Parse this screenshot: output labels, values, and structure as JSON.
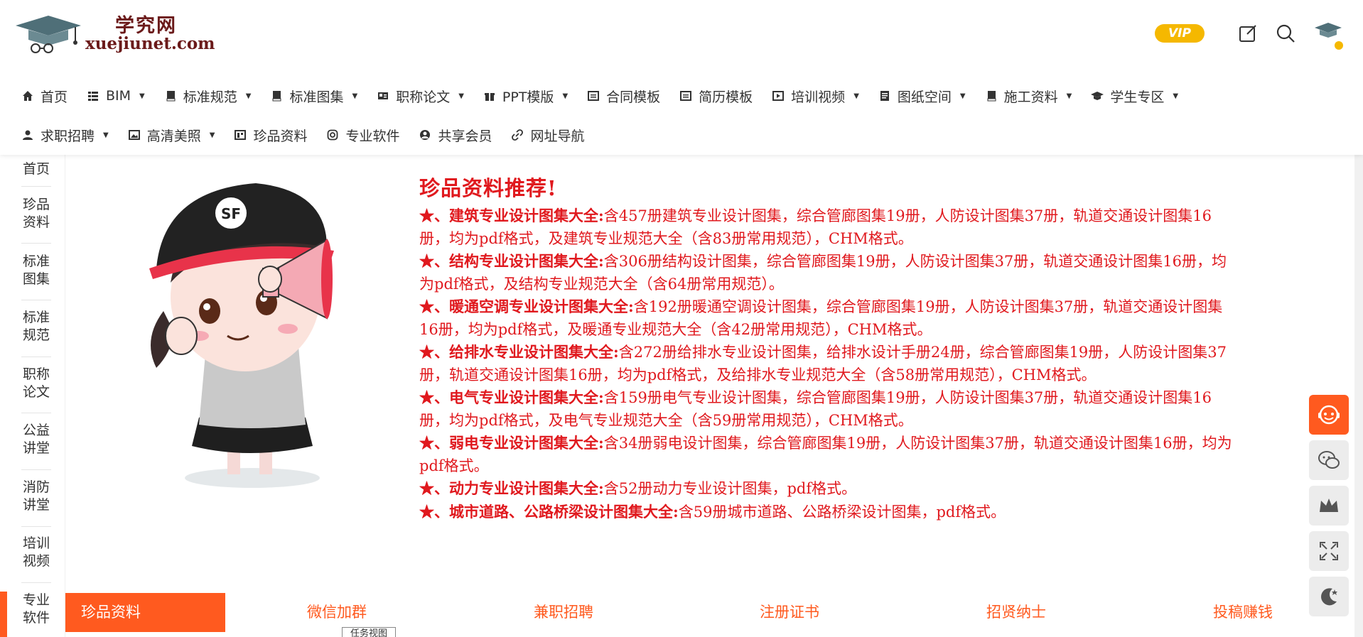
{
  "brand": {
    "title": "学究网",
    "url": "xuejiunet.com"
  },
  "header_right": {
    "vip_label": "VIP",
    "icons": [
      "edit-icon",
      "search-icon",
      "avatar"
    ],
    "avatar_caption": "学究网"
  },
  "nav": {
    "row1": [
      {
        "label": "首页",
        "icon": "home-icon",
        "dropdown": false
      },
      {
        "label": "BIM",
        "icon": "grid-icon",
        "dropdown": true
      },
      {
        "label": "标准规范",
        "icon": "book-icon",
        "dropdown": true
      },
      {
        "label": "标准图集",
        "icon": "book-icon",
        "dropdown": true
      },
      {
        "label": "职称论文",
        "icon": "id-card-icon",
        "dropdown": true
      },
      {
        "label": "PPT模版",
        "icon": "gift-icon",
        "dropdown": true
      },
      {
        "label": "合同模板",
        "icon": "list-icon",
        "dropdown": false
      },
      {
        "label": "简历模板",
        "icon": "list-icon",
        "dropdown": false
      },
      {
        "label": "培训视频",
        "icon": "video-icon",
        "dropdown": true
      },
      {
        "label": "图纸空间",
        "icon": "doc-icon",
        "dropdown": true
      },
      {
        "label": "施工资料",
        "icon": "book-icon",
        "dropdown": true
      },
      {
        "label": "学生专区",
        "icon": "graduation-cap-icon",
        "dropdown": true
      }
    ],
    "row2": [
      {
        "label": "求职招聘",
        "icon": "user-icon",
        "dropdown": true
      },
      {
        "label": "高清美照",
        "icon": "image-icon",
        "dropdown": true
      },
      {
        "label": "珍品资料",
        "icon": "folder-icon",
        "dropdown": false
      },
      {
        "label": "专业软件",
        "icon": "instagram-icon",
        "dropdown": false
      },
      {
        "label": "共享会员",
        "icon": "share-icon",
        "dropdown": false
      },
      {
        "label": "网址导航",
        "icon": "link-icon",
        "dropdown": false
      }
    ]
  },
  "leftnav": {
    "items": [
      {
        "label": "首页"
      },
      {
        "label": "珍品资料"
      },
      {
        "label": "标准图集"
      },
      {
        "label": "标准规范"
      },
      {
        "label": "职称论文"
      },
      {
        "label": "公益讲堂"
      },
      {
        "label": "消防讲堂"
      },
      {
        "label": "培训视频"
      },
      {
        "label": "专业软件"
      }
    ]
  },
  "banner": {
    "title": "珍品资料推荐!",
    "items": [
      {
        "key": "★、建筑专业设计图集大全:",
        "text": "含457册建筑专业设计图集，综合管廊图集19册，人防设计图集37册，轨道交通设计图集16册，均为pdf格式，及建筑专业规范大全（含83册常用规范），CHM格式。"
      },
      {
        "key": "★、结构专业设计图集大全:",
        "text": "含306册结构设计图集，综合管廊图集19册，人防设计图集37册，轨道交通设计图集16册，均为pdf格式，及结构专业规范大全（含64册常用规范）。"
      },
      {
        "key": "★、暖通空调专业设计图集大全:",
        "text": "含192册暖通空调设计图集，综合管廊图集19册，人防设计图集37册，轨道交通设计图集16册，均为pdf格式，及暖通专业规范大全（含42册常用规范），CHM格式。"
      },
      {
        "key": "★、给排水专业设计图集大全:",
        "text": "含272册给排水专业设计图集，给排水设计手册24册，综合管廊图集19册，人防设计图集37册，轨道交通设计图集16册，均为pdf格式，及给排水专业规范大全（含58册常用规范），CHM格式。"
      },
      {
        "key": "★、电气专业设计图集大全:",
        "text": "含159册电气专业设计图集，综合管廊图集19册，人防设计图集37册，轨道交通设计图集16册，均为pdf格式，及电气专业规范大全（含59册常用规范），CHM格式。"
      },
      {
        "key": "★、弱电专业设计图集大全:",
        "text": "含34册弱电设计图集，综合管廊图集19册，人防设计图集37册，轨道交通设计图集16册，均为pdf格式。"
      },
      {
        "key": "★、动力专业设计图集大全:",
        "text": "含52册动力专业设计图集，pdf格式。"
      },
      {
        "key": "★、城市道路、公路桥梁设计图集大全:",
        "text": "含59册城市道路、公路桥梁设计图集，pdf格式。"
      }
    ]
  },
  "bottombar": {
    "active": "珍品资料",
    "links": [
      "微信加群",
      "兼职招聘",
      "注册证书",
      "招贤纳士",
      "投稿赚钱"
    ],
    "tooltip": "任务视图"
  },
  "floatbar": [
    "customer-service-icon",
    "wechat-icon",
    "crown-icon",
    "fullscreen-icon",
    "moon-icon"
  ],
  "colors": {
    "accent": "#ff5a1f",
    "banner_red": "#e0191e",
    "vip": "#f5b800",
    "brand_text": "#6b1a1a"
  }
}
